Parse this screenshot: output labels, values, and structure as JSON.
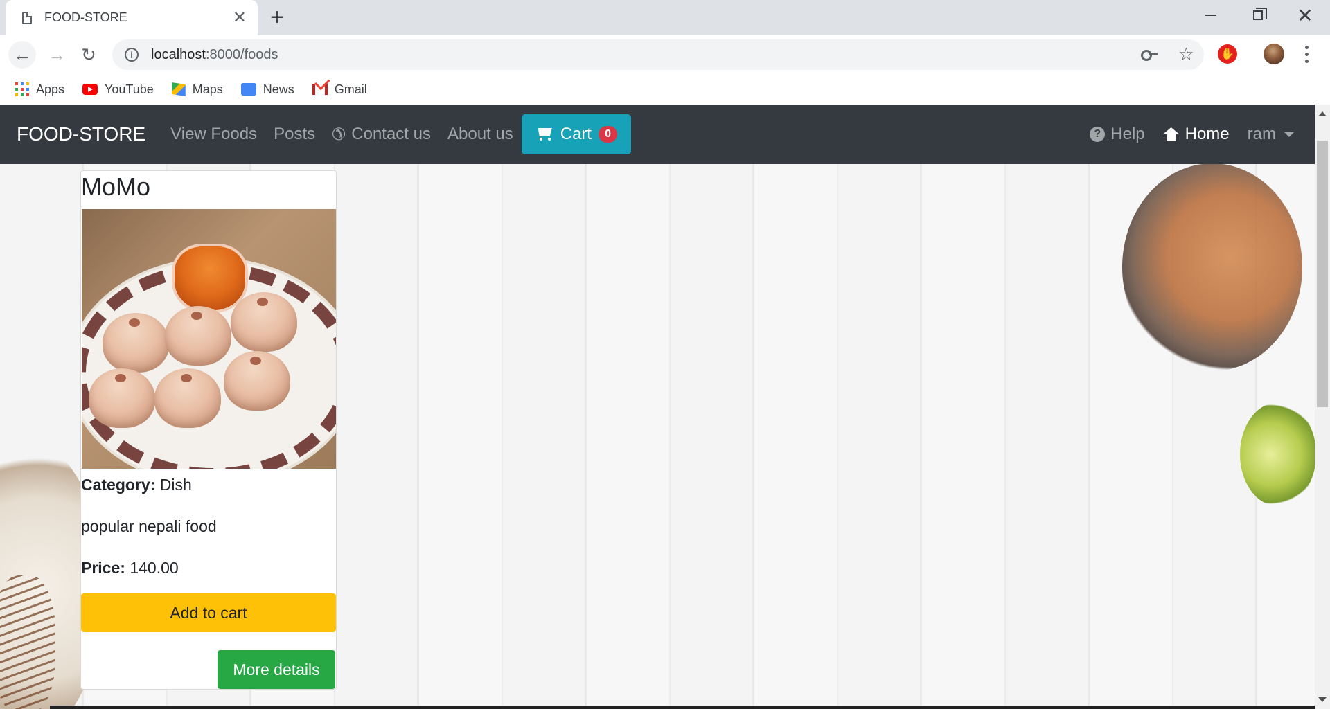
{
  "browser": {
    "tab_title": "FOOD-STORE",
    "tab_close": "✕",
    "new_tab": "+",
    "url_host": "localhost",
    "url_rest": ":8000/foods",
    "back": "←",
    "forward": "→",
    "reload": "↻",
    "star": "☆",
    "window_close": "✕",
    "bookmarks": [
      {
        "label": "Apps"
      },
      {
        "label": "YouTube"
      },
      {
        "label": "Maps"
      },
      {
        "label": "News"
      },
      {
        "label": "Gmail"
      }
    ]
  },
  "navbar": {
    "brand": "FOOD-STORE",
    "links": [
      "View Foods",
      "Posts",
      "Contact us",
      "About us"
    ],
    "cart_label": "Cart",
    "cart_count": "0",
    "help": "Help",
    "home": "Home",
    "user": "ram"
  },
  "food": {
    "name": "MoMo",
    "category_label": "Category:",
    "category": "Dish",
    "description": "popular nepali food",
    "price_label": "Price:",
    "price": "140.00",
    "add_to_cart": "Add to cart",
    "more_details": "More details"
  },
  "colors": {
    "navbar_bg": "#343a40",
    "cart_button": "#17a2b8",
    "badge": "#dc3545",
    "add_button": "#ffc107",
    "more_button": "#28a745"
  }
}
